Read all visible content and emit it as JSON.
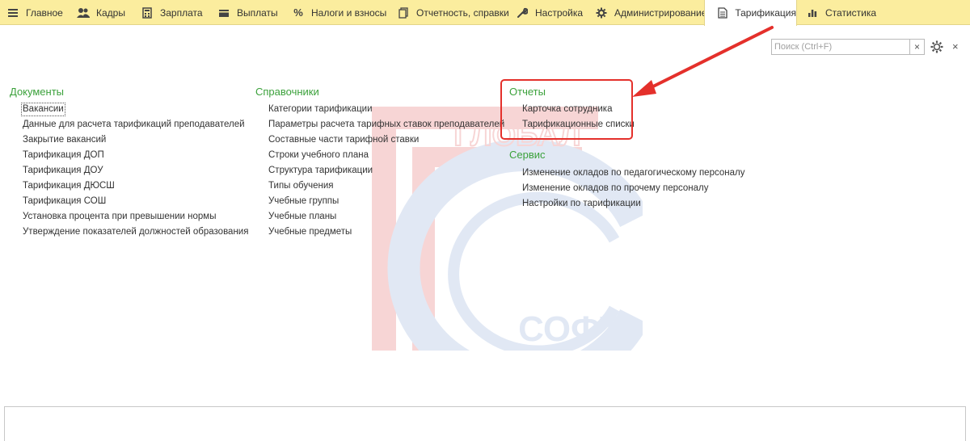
{
  "tabs": [
    {
      "label": "Главное",
      "icon": "menu-icon"
    },
    {
      "label": "Кадры",
      "icon": "users-icon"
    },
    {
      "label": "Зарплата",
      "icon": "calculator-icon"
    },
    {
      "label": "Выплаты",
      "icon": "wallet-icon"
    },
    {
      "label": "Налоги и взносы",
      "icon": "percent-icon"
    },
    {
      "label": "Отчетность, справки",
      "icon": "documents-icon"
    },
    {
      "label": "Настройка",
      "icon": "wrench-icon"
    },
    {
      "label": "Администрирование",
      "icon": "gear-icon"
    },
    {
      "label": "Тарификация",
      "icon": "document-icon",
      "active": true
    },
    {
      "label": "Статистика",
      "icon": "bar-chart-icon"
    }
  ],
  "search": {
    "placeholder": "Поиск (Ctrl+F)",
    "value": "",
    "clear": "×"
  },
  "window": {
    "close": "×"
  },
  "sections": {
    "documents": {
      "title": "Документы",
      "items": [
        "Вакансии",
        "Данные для расчета тарификаций преподавателей",
        "Закрытие вакансий",
        "Тарификация ДОП",
        "Тарификация ДОУ",
        "Тарификация ДЮСШ",
        "Тарификация СОШ",
        "Установка процента при превышении нормы",
        "Утверждение показателей должностей образования"
      ]
    },
    "references": {
      "title": "Справочники",
      "items": [
        "Категории тарификации",
        "Параметры расчета тарифных ставок преподавателей",
        "Составные части тарифной ставки",
        "Строки учебного плана",
        "Структура тарификации",
        "Типы обучения",
        "Учебные группы",
        "Учебные планы",
        "Учебные предметы"
      ]
    },
    "reports": {
      "title": "Отчеты",
      "items": [
        "Карточка сотрудника",
        "Тарификационные списки"
      ]
    },
    "service": {
      "title": "Сервис",
      "items": [
        "Изменение окладов по педагогическому персоналу",
        "Изменение окладов по прочему персоналу",
        "Настройки по тарификации"
      ]
    }
  },
  "watermark": {
    "text_top": "ГЛОБАЛ",
    "text_bottom": "СОФТ"
  },
  "colors": {
    "tabbar": "#fbed9e",
    "section_title": "#3ba13b",
    "annotation": "#e4302b"
  }
}
